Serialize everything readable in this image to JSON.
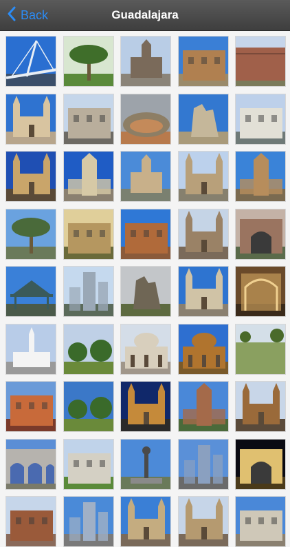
{
  "navbar": {
    "back_label": "Back",
    "back_icon": "chevron-left-icon",
    "title": "Guadalajara",
    "accent_color": "#2b8cf6",
    "background_color": "#4a4a4a"
  },
  "gallery": {
    "columns": 5,
    "thumbnails": [
      {
        "subject": "bridge",
        "sky": "#2a6fd1",
        "ground": "#3b4f6a",
        "building": "#e8eef5"
      },
      {
        "subject": "palm",
        "sky": "#d8e6d0",
        "ground": "#5a8a3a",
        "building": "#3f6e2a"
      },
      {
        "subject": "church",
        "sky": "#b9cde6",
        "ground": "#8b8479",
        "building": "#7a6a5a"
      },
      {
        "subject": "building",
        "sky": "#3a7fd6",
        "ground": "#9a8a6a",
        "building": "#b08050"
      },
      {
        "subject": "wall",
        "sky": "#c6d5ea",
        "ground": "#7a7a5a",
        "building": "#a0604a"
      },
      {
        "subject": "cathedral",
        "sky": "#2f73d0",
        "ground": "#b7a58c",
        "building": "#d8c4a0"
      },
      {
        "subject": "building",
        "sky": "#c5d6ea",
        "ground": "#6d6a64",
        "building": "#b9ae9c"
      },
      {
        "subject": "arena",
        "sky": "#9da3aa",
        "ground": "#b87a4c",
        "building": "#8d7e65"
      },
      {
        "subject": "ruin",
        "sky": "#3378d0",
        "ground": "#a99a7a",
        "building": "#c5b79a"
      },
      {
        "subject": "building",
        "sky": "#bdd0ea",
        "ground": "#6f7a78",
        "building": "#e2e0d6"
      },
      {
        "subject": "cathedral",
        "sky": "#1f4fb3",
        "ground": "#5a4a38",
        "building": "#c9a56a"
      },
      {
        "subject": "tower",
        "sky": "#1f5cc5",
        "ground": "#8a8070",
        "building": "#d6c9a6"
      },
      {
        "subject": "church",
        "sky": "#4b8bd8",
        "ground": "#7a8070",
        "building": "#c8b08a"
      },
      {
        "subject": "cathedral",
        "sky": "#bcd1ec",
        "ground": "#86806e",
        "building": "#b8a07a"
      },
      {
        "subject": "tower",
        "sky": "#3a83d8",
        "ground": "#7a6a50",
        "building": "#b78d5c"
      },
      {
        "subject": "palm",
        "sky": "#6aa2df",
        "ground": "#6a7a5a",
        "building": "#4a6a3a"
      },
      {
        "subject": "building",
        "sky": "#e0cf9a",
        "ground": "#6a6a3a",
        "building": "#b59760"
      },
      {
        "subject": "building",
        "sky": "#2f78d6",
        "ground": "#8a5a3a",
        "building": "#b06a3a"
      },
      {
        "subject": "cathedral",
        "sky": "#c5d4e6",
        "ground": "#7a6a5a",
        "building": "#9a8266"
      },
      {
        "subject": "arch",
        "sky": "#c4b2a6",
        "ground": "#5a6a4a",
        "building": "#9a7460"
      },
      {
        "subject": "kiosk",
        "sky": "#3a80d8",
        "ground": "#4a5a4a",
        "building": "#3a5a5a"
      },
      {
        "subject": "skyscraper",
        "sky": "#c5d9ee",
        "ground": "#5a6a5a",
        "building": "#9aa8b6"
      },
      {
        "subject": "ruin",
        "sky": "#c3c6c9",
        "ground": "#5d6a40",
        "building": "#6f6655"
      },
      {
        "subject": "cathedral",
        "sky": "#2e74d0",
        "ground": "#8a8070",
        "building": "#d0c3a6"
      },
      {
        "subject": "interior",
        "sky": "#6a4a2a",
        "ground": "#3a2a1a",
        "building": "#c59a5a"
      },
      {
        "subject": "temple",
        "sky": "#b8cce8",
        "ground": "#9a9a9a",
        "building": "#f4f4f4"
      },
      {
        "subject": "garden",
        "sky": "#bfd0e6",
        "ground": "#6a8a3a",
        "building": "#b7a080"
      },
      {
        "subject": "theater",
        "sky": "#d4dde8",
        "ground": "#a0968a",
        "building": "#d8cfbd"
      },
      {
        "subject": "theater",
        "sky": "#2e6fd0",
        "ground": "#7a5a2a",
        "building": "#b0742e"
      },
      {
        "subject": "field",
        "sky": "#d4dfe8",
        "ground": "#6f8a3a",
        "building": "#8aa060"
      },
      {
        "subject": "building",
        "sky": "#6a9ad8",
        "ground": "#7a3a2a",
        "building": "#c86a3a"
      },
      {
        "subject": "garden",
        "sky": "#3b78c8",
        "ground": "#4d7a3a",
        "building": "#3a4a3a"
      },
      {
        "subject": "cathedral",
        "sky": "#10286a",
        "ground": "#2a2a2a",
        "building": "#c58a3a"
      },
      {
        "subject": "tower",
        "sky": "#4a88d8",
        "ground": "#4a6a3a",
        "building": "#a46a4a"
      },
      {
        "subject": "cathedral",
        "sky": "#c8d6e8",
        "ground": "#5a4a3a",
        "building": "#9a6a3a"
      },
      {
        "subject": "aqueduct",
        "sky": "#5a8ed6",
        "ground": "#7a7a6a",
        "building": "#b6b3ae"
      },
      {
        "subject": "building",
        "sky": "#c0d3ea",
        "ground": "#5a8a3a",
        "building": "#d4d0c4"
      },
      {
        "subject": "sculpture",
        "sky": "#4c8ad8",
        "ground": "#6a7a5a",
        "building": "#4a4a4a"
      },
      {
        "subject": "skyscraper",
        "sky": "#5a90d8",
        "ground": "#6a6a6a",
        "building": "#8aa0c0"
      },
      {
        "subject": "arch",
        "sky": "#0a0a12",
        "ground": "#4a3a1a",
        "building": "#e0c070"
      },
      {
        "subject": "building",
        "sky": "#c6d6ea",
        "ground": "#8a6a5a",
        "building": "#9a5a3a"
      },
      {
        "subject": "skyscraper",
        "sky": "#4a8ad8",
        "ground": "#7a7a7a",
        "building": "#a0b0c6"
      },
      {
        "subject": "cathedral",
        "sky": "#3a7fd6",
        "ground": "#7a6a5a",
        "building": "#c4ac80"
      },
      {
        "subject": "cathedral",
        "sky": "#c6d5e8",
        "ground": "#7a6a5a",
        "building": "#b59a70"
      },
      {
        "subject": "building",
        "sky": "#4a88d8",
        "ground": "#8a8070",
        "building": "#cfc8b8"
      }
    ]
  }
}
